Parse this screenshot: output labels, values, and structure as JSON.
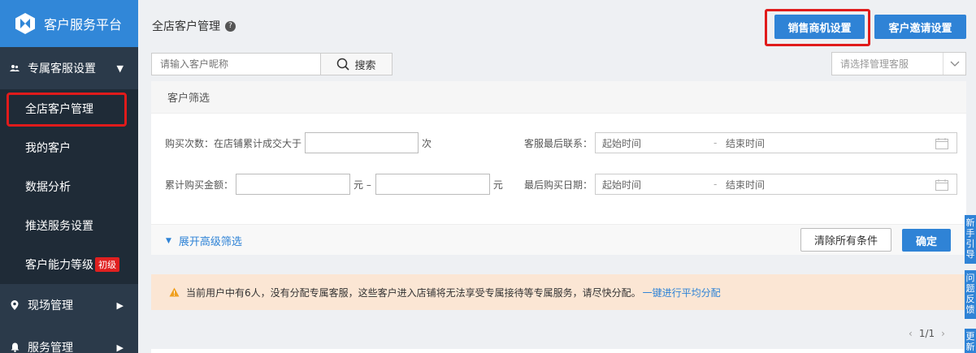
{
  "app": {
    "title": "客户服务平台"
  },
  "sidebar": {
    "group1": {
      "label": "专属客服设置"
    },
    "items": [
      {
        "label": "全店客户管理"
      },
      {
        "label": "我的客户"
      },
      {
        "label": "数据分析"
      },
      {
        "label": "推送服务设置"
      },
      {
        "label": "客户能力等级",
        "badge": "初级"
      }
    ],
    "group2": {
      "label": "现场管理"
    },
    "group3": {
      "label": "服务管理"
    }
  },
  "header": {
    "title": "全店客户管理",
    "btn_sales": "销售商机设置",
    "btn_invite": "客户邀请设置"
  },
  "search": {
    "placeholder": "请输入客户昵称",
    "button": "搜索",
    "select_placeholder": "请选择管理客服"
  },
  "filter": {
    "title": "客户筛选",
    "purchase_label": "购买次数：在店铺累计成交大于",
    "purchase_unit": "次",
    "last_contact_label": "客服最后联系：",
    "amount_label": "累计购买金额：",
    "amount_unit1": "元 –",
    "amount_unit2": "元",
    "last_buy_label": "最后购买日期：",
    "start_placeholder": "起始时间",
    "end_placeholder": "结束时间",
    "expand": "展开高级筛选",
    "clear": "清除所有条件",
    "confirm": "确定"
  },
  "alert": {
    "text": "当前用户中有6人，没有分配专属客服，这些客户进入店铺将无法享受专属接待等专属服务，请尽快分配。",
    "link": "一键进行平均分配"
  },
  "pager": {
    "prev": "‹",
    "text": "1/1",
    "next": "›"
  },
  "side_tabs": [
    "新手引导",
    "问题反馈",
    "更新"
  ],
  "colors": {
    "primary": "#2f83d6",
    "sidebar": "#2b3a4a",
    "highlight": "#e01b1b"
  }
}
